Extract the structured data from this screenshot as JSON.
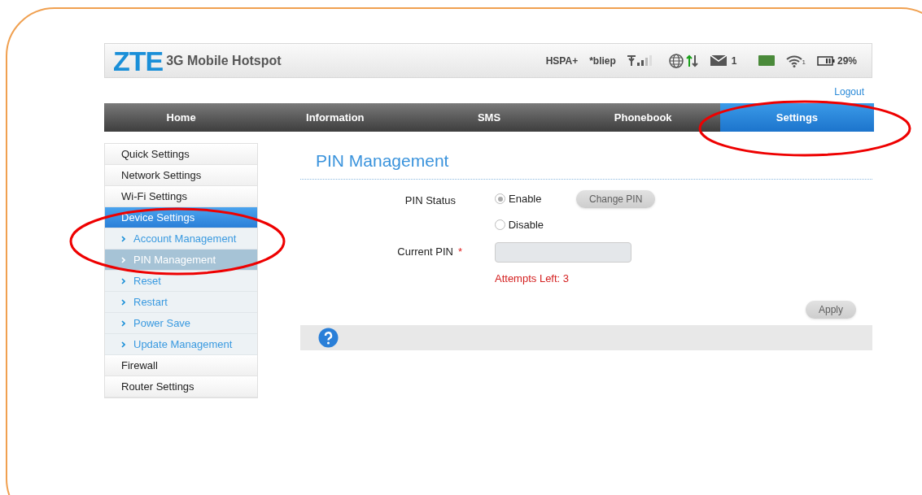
{
  "header": {
    "logo": "ZTE",
    "product": "3G Mobile Hotspot",
    "network_type": "HSPA+",
    "operator": "*bliep",
    "sms_count": "1",
    "wifi_clients": "1",
    "battery": "29%"
  },
  "logout": "Logout",
  "nav": [
    {
      "label": "Home",
      "selected": false
    },
    {
      "label": "Information",
      "selected": false
    },
    {
      "label": "SMS",
      "selected": false
    },
    {
      "label": "Phonebook",
      "selected": false
    },
    {
      "label": "Settings",
      "selected": true
    }
  ],
  "sidebar": [
    {
      "label": "Quick Settings",
      "selected": false
    },
    {
      "label": "Network Settings",
      "selected": false
    },
    {
      "label": "Wi-Fi Settings",
      "selected": false
    },
    {
      "label": "Device Settings",
      "selected": true,
      "children": [
        {
          "label": "Account Management",
          "selected": false
        },
        {
          "label": "PIN Management",
          "selected": true
        },
        {
          "label": "Reset",
          "selected": false
        },
        {
          "label": "Restart",
          "selected": false
        },
        {
          "label": "Power Save",
          "selected": false
        },
        {
          "label": "Update Management",
          "selected": false
        }
      ]
    },
    {
      "label": "Firewall",
      "selected": false
    },
    {
      "label": "Router Settings",
      "selected": false
    }
  ],
  "page_title": "PIN Management",
  "form": {
    "pin_status_label": "PIN Status",
    "options": [
      {
        "label": "Enable",
        "selected": true
      },
      {
        "label": "Disable",
        "selected": false
      }
    ],
    "change_pin_button": {
      "label": "Change PIN",
      "disabled": true
    },
    "current_pin_label": "Current PIN",
    "required_mark": "*",
    "attempts": "Attempts Left: 3",
    "apply_button": {
      "label": "Apply",
      "disabled": true
    }
  }
}
